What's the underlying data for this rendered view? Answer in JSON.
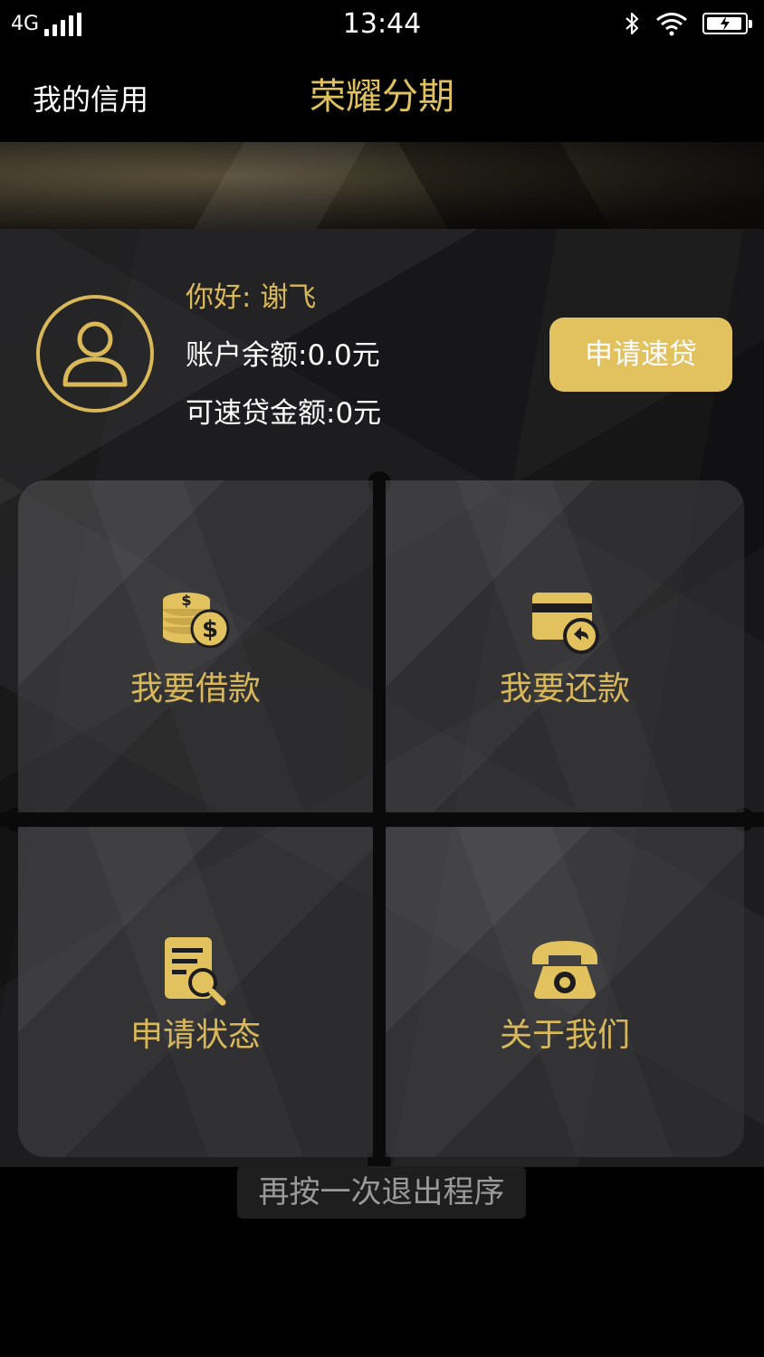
{
  "status_bar": {
    "network": "4G",
    "time": "13:44"
  },
  "nav": {
    "left_label": "我的信用",
    "title": "荣耀分期"
  },
  "profile": {
    "greeting": "你好: 谢飞",
    "balance": "账户余额:0.0元",
    "quota": "可速贷金额:0元",
    "apply_button": "申请速贷"
  },
  "menu": {
    "borrow": "我要借款",
    "repay": "我要还款",
    "status": "申请状态",
    "about": "关于我们"
  },
  "toast": {
    "message": "再按一次退出程序"
  },
  "colors": {
    "accent": "#d9b85a",
    "button": "#e2c15f",
    "background": "#1d1d1f"
  }
}
